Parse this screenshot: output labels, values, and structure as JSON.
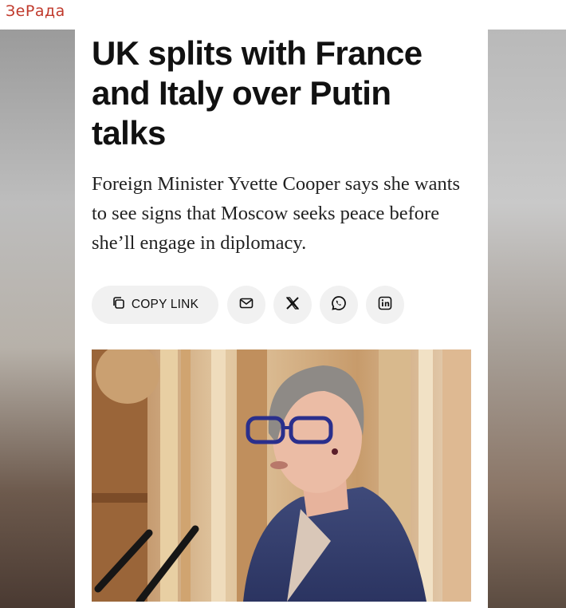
{
  "watermark": "ЗеРада",
  "article": {
    "headline": "UK splits with France and Italy over Putin talks",
    "dek": "Foreign Minister Yvette Cooper says she wants to see signs that Moscow seeks peace before she’ll engage in diplomacy.",
    "share": {
      "copy_link_label": "COPY LINK",
      "icons": [
        "copy-icon",
        "mail-icon",
        "x-icon",
        "whatsapp-icon",
        "linkedin-icon"
      ]
    }
  },
  "colors": {
    "watermark": "#c0392b",
    "headline": "#111111",
    "button_bg": "#f1f1f1"
  }
}
